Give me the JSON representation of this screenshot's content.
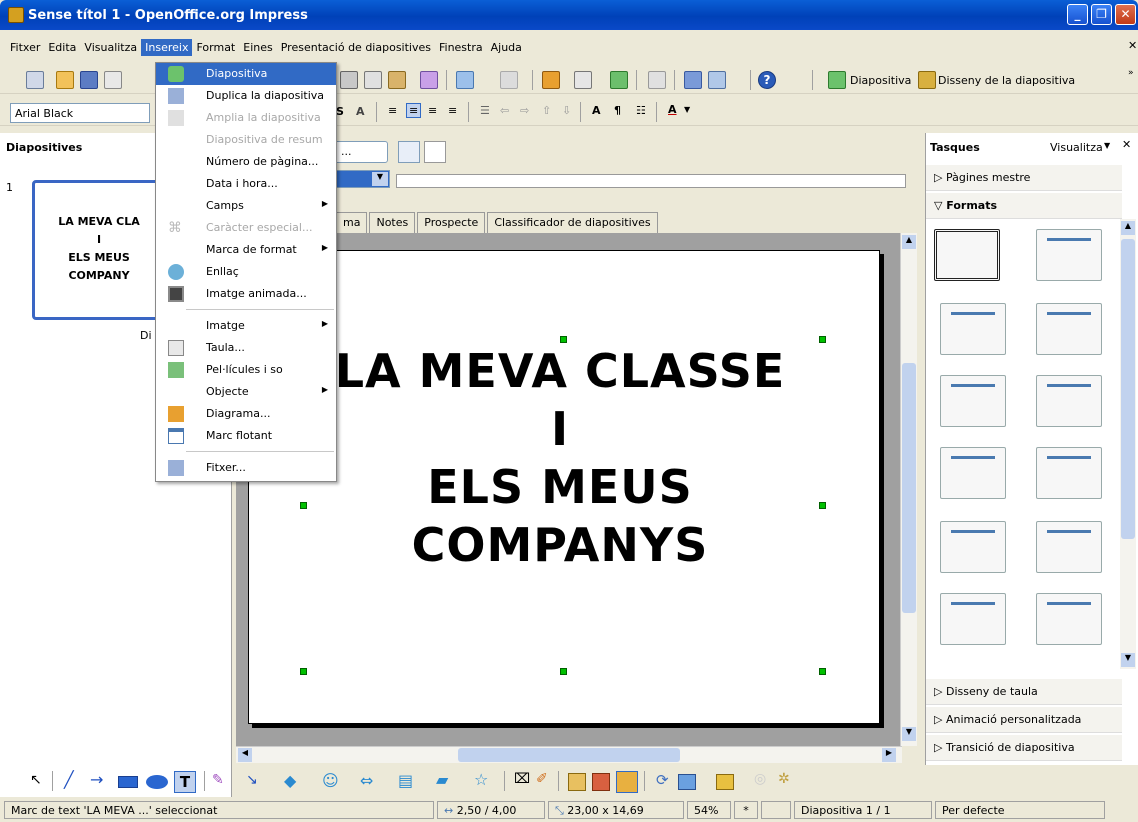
{
  "window": {
    "title": "Sense títol 1 - OpenOffice.org Impress"
  },
  "menu": [
    "Fitxer",
    "Edita",
    "Visualitza",
    "Insereix",
    "Format",
    "Eines",
    "Presentació de diapositives",
    "Finestra",
    "Ajuda"
  ],
  "toolbar": {
    "new_slide_label": "Diapositiva",
    "slide_design_label": "Disseny de la diapositiva",
    "font_name": "Arial Black"
  },
  "insert_menu": [
    {
      "label": "Diapositiva",
      "state": "highlighted"
    },
    {
      "label": "Duplica la diapositiva",
      "state": "normal"
    },
    {
      "label": "Amplia la diapositiva",
      "state": "disabled"
    },
    {
      "label": "Diapositiva de resum",
      "state": "disabled"
    },
    {
      "label": "Número de pàgina...",
      "state": "normal"
    },
    {
      "label": "Data i hora...",
      "state": "normal"
    },
    {
      "label": "Camps",
      "state": "submenu"
    },
    {
      "label": "Caràcter especial...",
      "state": "disabled"
    },
    {
      "label": "Marca de format",
      "state": "submenu"
    },
    {
      "label": "Enllaç",
      "state": "normal"
    },
    {
      "label": "Imatge animada...",
      "state": "normal"
    },
    {
      "label": "Imatge",
      "state": "submenu"
    },
    {
      "label": "Taula...",
      "state": "normal"
    },
    {
      "label": "Pel·lícules i so",
      "state": "normal"
    },
    {
      "label": "Objecte",
      "state": "submenu"
    },
    {
      "label": "Diagrama...",
      "state": "normal"
    },
    {
      "label": "Marc flotant",
      "state": "normal"
    },
    {
      "label": "Fitxer...",
      "state": "normal"
    }
  ],
  "slides_panel": {
    "title": "Diapositives",
    "slide_number": "1",
    "thumb_lines": [
      "LA MEVA CLA",
      "I",
      "ELS MEUS",
      "COMPANY"
    ],
    "caption": "Di"
  },
  "view_tabs": [
    "ma",
    "Notes",
    "Prospecte",
    "Classificador de diapositives"
  ],
  "slide": {
    "lines": [
      "LA MEVA CLASSE",
      "I",
      "ELS MEUS",
      "COMPANYS"
    ]
  },
  "tasks": {
    "title": "Tasques",
    "view_label": "Visualitza",
    "master_pages": "Pàgines mestre",
    "layouts": "Formats",
    "table_design": "Disseny de taula",
    "custom_animation": "Animació personalitzada",
    "slide_transition": "Transició de diapositiva"
  },
  "status": {
    "selection": "Marc de text 'LA MEVA ...' seleccionat",
    "position": "2,50 / 4,00",
    "size": "23,00 x 14,69",
    "zoom": "54%",
    "modified": "*",
    "slide": "Diapositiva 1 / 1",
    "master": "Per defecte"
  }
}
